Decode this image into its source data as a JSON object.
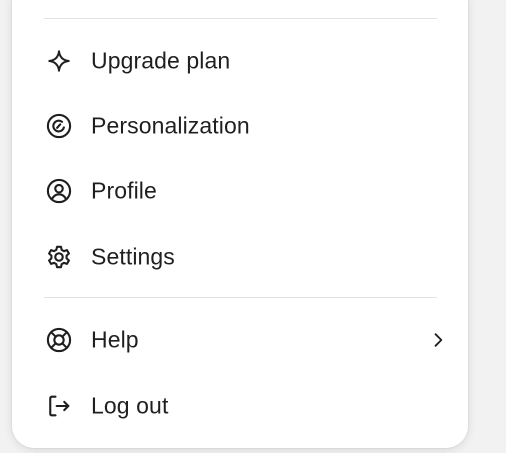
{
  "menu": {
    "items": [
      {
        "label": "Upgrade plan",
        "icon": "sparkle-icon"
      },
      {
        "label": "Personalization",
        "icon": "personalization-icon"
      },
      {
        "label": "Profile",
        "icon": "profile-icon"
      },
      {
        "label": "Settings",
        "icon": "gear-icon"
      }
    ],
    "footer_items": [
      {
        "label": "Help",
        "icon": "lifebuoy-icon",
        "has_submenu": true
      },
      {
        "label": "Log out",
        "icon": "logout-icon"
      }
    ]
  },
  "colors": {
    "text": "#1f1f1f",
    "icon": "#1f1f1f",
    "divider": "#e3e3e3",
    "menu_bg": "#ffffff"
  }
}
